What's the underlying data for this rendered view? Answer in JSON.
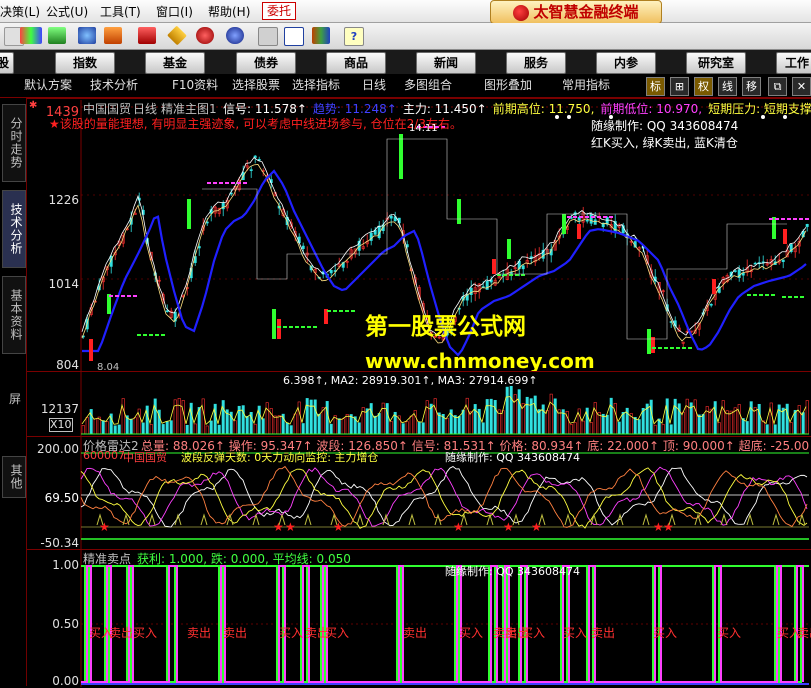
{
  "menu": {
    "items": [
      "决策(L)",
      "公式(U)",
      "工具(T)",
      "窗口(I)",
      "帮助(H)"
    ],
    "trade_label": "委托",
    "brand": "太智慧金融终端"
  },
  "navbar": {
    "items": [
      "股",
      "指数",
      "基金",
      "债券",
      "商品",
      "新闻",
      "服务",
      "内参",
      "研究室",
      "工作"
    ]
  },
  "subbar": {
    "items": [
      "默认方案",
      "技术分析",
      "F10资料",
      "选择股票",
      "选择指标",
      "日线",
      "多图组合",
      "图形叠加",
      "常用指标"
    ],
    "icons": [
      "标",
      "⊞",
      "权",
      "线",
      "移",
      "⧉",
      "✕"
    ]
  },
  "lefttabs": [
    "分时走势",
    "技术分析",
    "基本资料",
    "其他"
  ],
  "main": {
    "stock": "中国国贸",
    "period": "日线",
    "indicator": "精准主图1",
    "fields": [
      {
        "label": "信号:",
        "value": "11.578↑",
        "color": "#ffffff"
      },
      {
        "label": "趋势:",
        "value": "11.248↑",
        "color": "#4040ff"
      },
      {
        "label": "主力:",
        "value": "11.450↑",
        "color": "#ffffff"
      },
      {
        "label": "前期高位:",
        "value": "11.750,",
        "color": "#ffff40"
      },
      {
        "label": "前期低位:",
        "value": "10.970,",
        "color": "#ff40ff"
      },
      {
        "label": "短期压力:",
        "value": "短期支撑",
        "color": "#ffff40"
      }
    ],
    "comment": "★该股的量能理想, 有明显主强迹象, 可以考虑中线进场参与, 仓位在2/3左右。",
    "credit": "随缘制作: QQ 343608474",
    "legend": "红K买入, 绿K卖出, 蓝K清仓",
    "peak_label": "14.11",
    "low_label": "8.04",
    "yaxis": [
      "1439",
      "1226",
      "1014",
      "804"
    ]
  },
  "watermark": {
    "title": "第一股票公式网",
    "url": "www.chnmoney.com"
  },
  "volume": {
    "header": "6.398↑, MA2: 28919.301↑, MA3: 27914.699↑",
    "ylabel": "12137",
    "unit": "X10",
    "side": "屏"
  },
  "indicator2": {
    "name": "价格雷达2",
    "fields": "总量: 88.026↑ 操作: 95.347↑ 波段: 126.850↑ 信号: 81.531↑ 价格: 80.934↑ 底: 22.000↑ 顶: 90.000↑ 超底: -25.00",
    "code": "600007",
    "stock": "中国国贸",
    "sub": "波段反弹天数: 0天力动向监控: 主力增仓",
    "credit": "随缘制作: QQ 343608474",
    "yaxis": [
      "200.00",
      "69.50",
      "-50.34"
    ]
  },
  "indicator3": {
    "name": "精准卖点",
    "fields": "获利: 1.000, 跌: 0.000, 平均线: 0.050",
    "credit": "随缘制作: QQ 343608474",
    "yaxis": [
      "1.00",
      "0.50",
      "0.00"
    ],
    "signals": [
      "买入",
      "卖出",
      "买入",
      "卖出",
      "卖出",
      "买入",
      "卖出",
      "买入",
      "卖出",
      "买入",
      "卖出",
      "卖出",
      "买入",
      "买入",
      "卖出",
      "买入",
      "买入",
      "买入",
      "卖出"
    ]
  },
  "colors": {
    "up": "#ff3030",
    "down": "#30ff30",
    "trend": "#2020ff",
    "signal": "#ffffff",
    "magenta": "#ff40ff",
    "yellow": "#ffff40"
  }
}
